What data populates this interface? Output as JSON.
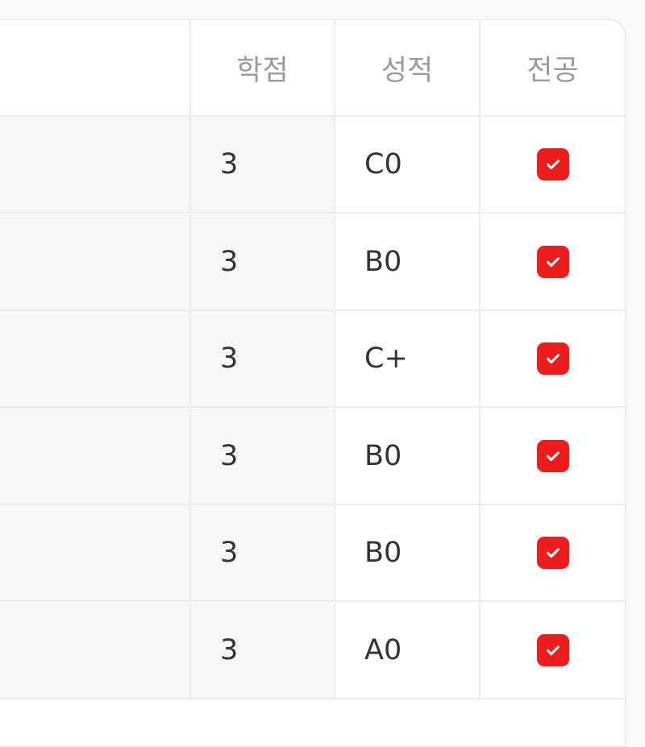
{
  "table": {
    "headers": {
      "name": "",
      "credit": "학점",
      "grade": "성적",
      "major": "전공"
    },
    "rows": [
      {
        "name": "",
        "credit": "3",
        "grade": "C0",
        "major": true
      },
      {
        "name": "",
        "credit": "3",
        "grade": "B0",
        "major": true
      },
      {
        "name": "",
        "credit": "3",
        "grade": "C+",
        "major": true
      },
      {
        "name": "",
        "credit": "3",
        "grade": "B0",
        "major": true
      },
      {
        "name": "",
        "credit": "3",
        "grade": "B0",
        "major": true
      },
      {
        "name": "",
        "credit": "3",
        "grade": "A0",
        "major": true
      }
    ]
  },
  "colors": {
    "checkbox": "#ee1d1d",
    "border": "#ececec",
    "header_text": "#9a9a9a"
  }
}
